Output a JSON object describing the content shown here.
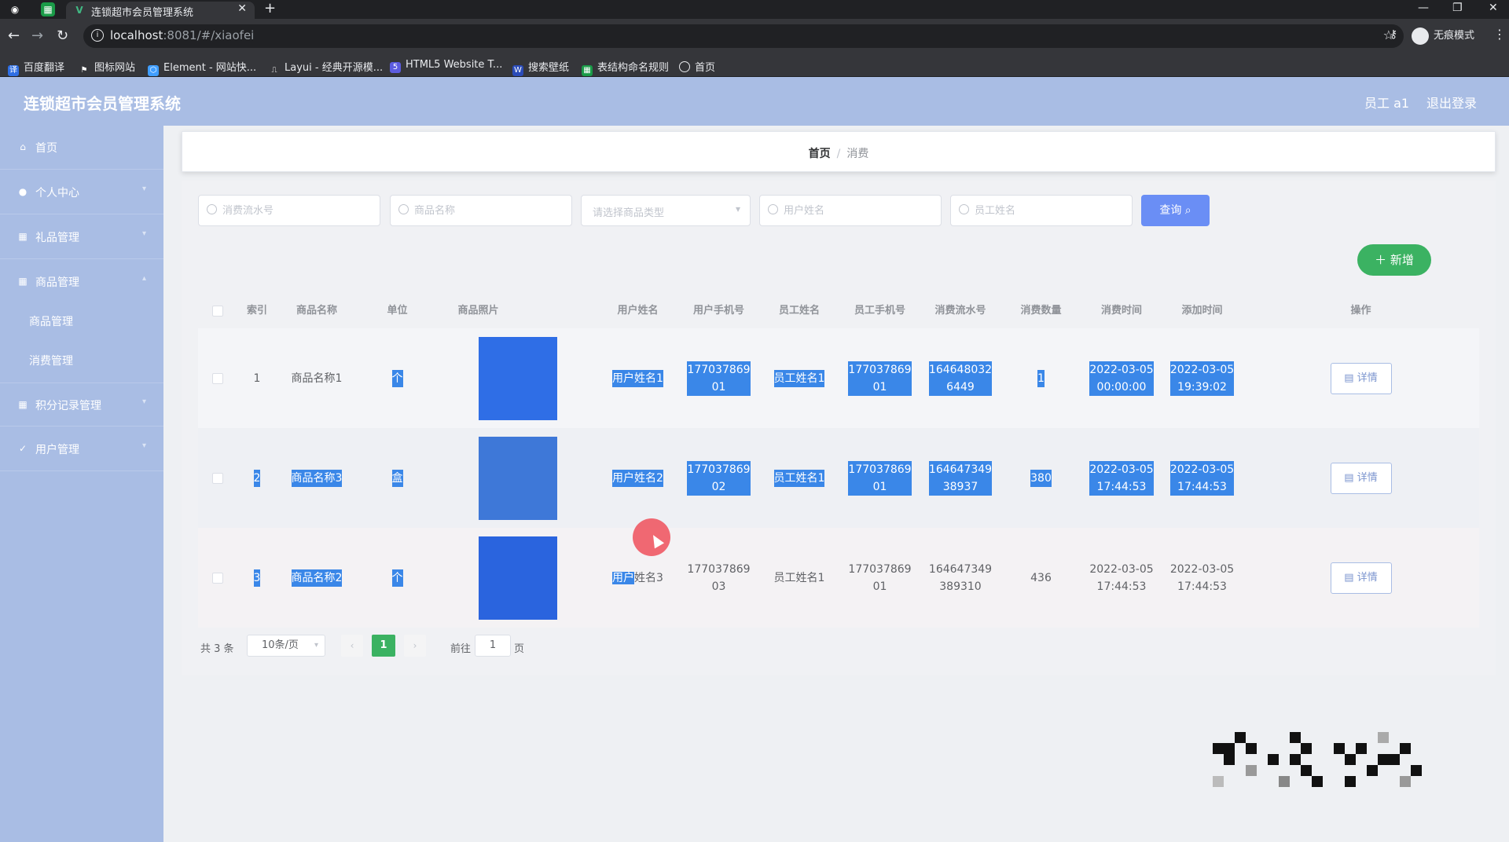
{
  "browser": {
    "tab_title": "连锁超市会员管理系统",
    "url_host": "localhost",
    "url_rest": ":8081/#/xiaofei",
    "incognito_label": "无痕模式",
    "bookmarks": [
      "百度翻译",
      "图标网站",
      "Element - 网站快...",
      "Layui - 经典开源模...",
      "HTML5 Website T...",
      "搜索壁纸",
      "表结构命名规则",
      "首页"
    ]
  },
  "header": {
    "title": "连锁超市会员管理系统",
    "user": "员工 a1",
    "logout": "退出登录"
  },
  "sidebar": {
    "items": [
      {
        "label": "首页",
        "icon": "home-icon"
      },
      {
        "label": "个人中心",
        "icon": "user-icon"
      },
      {
        "label": "礼品管理",
        "icon": "grid-icon"
      },
      {
        "label": "商品管理",
        "icon": "grid-icon"
      },
      {
        "label": "积分记录管理",
        "icon": "grid-icon"
      },
      {
        "label": "用户管理",
        "icon": "check-icon"
      }
    ],
    "submenu": [
      "商品管理",
      "消费管理"
    ]
  },
  "breadcrumb": {
    "home": "首页",
    "current": "消费"
  },
  "search": {
    "serial_placeholder": "消费流水号",
    "product_placeholder": "商品名称",
    "type_placeholder": "请选择商品类型",
    "user_placeholder": "用户姓名",
    "staff_placeholder": "员工姓名",
    "query_label": "查询"
  },
  "toolbar": {
    "add_label": "新增"
  },
  "table": {
    "headers": [
      "索引",
      "商品名称",
      "单位",
      "商品照片",
      "用户姓名",
      "用户手机号",
      "员工姓名",
      "员工手机号",
      "消费流水号",
      "消费数量",
      "消费时间",
      "添加时间",
      "操作"
    ],
    "rows": [
      {
        "index": "1",
        "product": "商品名称1",
        "unit": "个",
        "user": "用户姓名1",
        "user_phone_1": "177037869",
        "user_phone_2": "01",
        "staff": "员工姓名1",
        "staff_phone_1": "177037869",
        "staff_phone_2": "01",
        "serial_1": "164648032",
        "serial_2": "6449",
        "qty": "1",
        "consume_date": "2022-03-05",
        "consume_time": "00:00:00",
        "add_date": "2022-03-05",
        "add_time": "19:39:02",
        "action": "详情"
      },
      {
        "index": "2",
        "product": "商品名称3",
        "unit": "盒",
        "user": "用户姓名2",
        "user_phone_1": "177037869",
        "user_phone_2": "02",
        "staff": "员工姓名1",
        "staff_phone_1": "177037869",
        "staff_phone_2": "01",
        "serial_1": "164647349",
        "serial_2": "38937",
        "qty": "380",
        "consume_date": "2022-03-05",
        "consume_time": "17:44:53",
        "add_date": "2022-03-05",
        "add_time": "17:44:53",
        "action": "详情"
      },
      {
        "index": "3",
        "product": "商品名称2",
        "unit": "个",
        "user_a": "用户",
        "user_b": "姓名3",
        "user_phone_1": "177037869",
        "user_phone_2": "03",
        "staff": "员工姓名1",
        "staff_phone_1": "177037869",
        "staff_phone_2": "01",
        "serial_1": "164647349",
        "serial_2": "389310",
        "qty": "436",
        "consume_date": "2022-03-05",
        "consume_time": "17:44:53",
        "add_date": "2022-03-05",
        "add_time": "17:44:53",
        "action": "详情"
      }
    ]
  },
  "pagination": {
    "total": "共 3 条",
    "page_size": "10条/页",
    "current_page": "1",
    "goto_label": "前往",
    "goto_value": "1",
    "page_suffix": "页"
  },
  "colors": {
    "header_bg": "#a9bde4",
    "primary": "#6a8ef5",
    "success": "#3bb262",
    "selection": "#3a87e8"
  }
}
